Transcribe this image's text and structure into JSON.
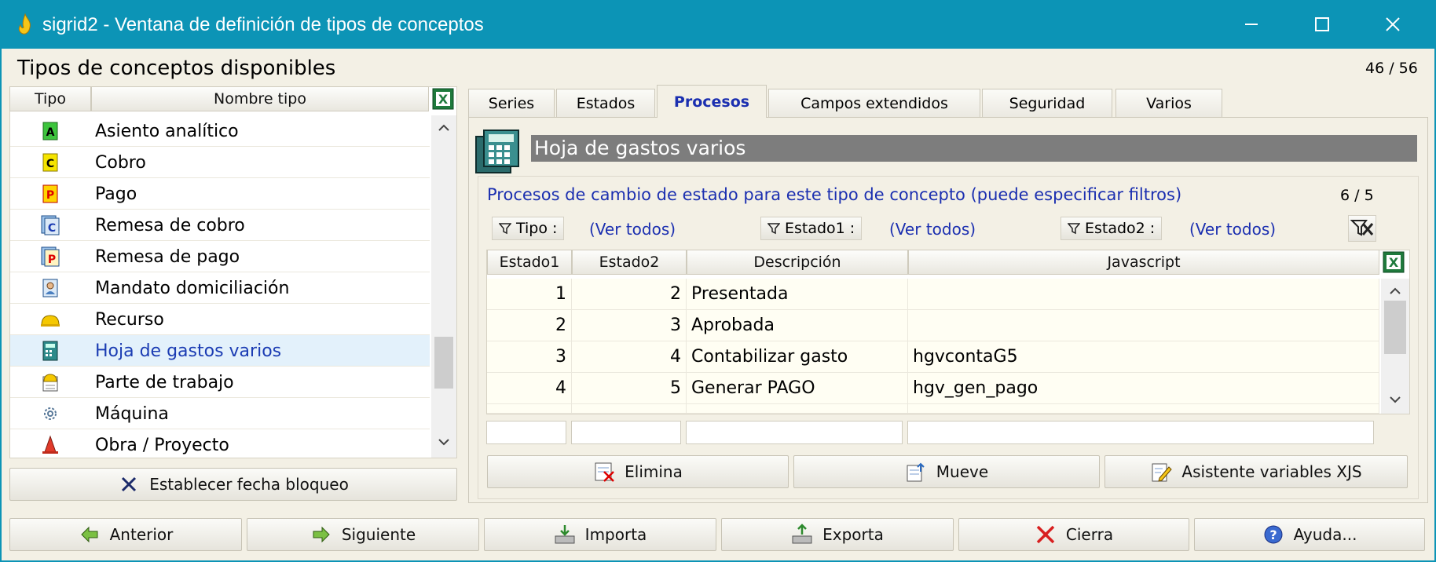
{
  "window": {
    "title": "sigrid2 - Ventana de definición de tipos de conceptos"
  },
  "left": {
    "heading": "Tipos de conceptos disponibles",
    "counter": "46 / 56",
    "columns": [
      "Tipo",
      "Nombre tipo"
    ],
    "items": [
      {
        "label": "Asiento analítico",
        "icon": "A-letter-icon"
      },
      {
        "label": "Cobro",
        "icon": "C-letter-icon"
      },
      {
        "label": "Pago",
        "icon": "P-letter-icon"
      },
      {
        "label": "Remesa de cobro",
        "icon": "remesa-cobro-icon"
      },
      {
        "label": "Remesa de pago",
        "icon": "remesa-pago-icon"
      },
      {
        "label": "Mandato domiciliación",
        "icon": "mandato-icon"
      },
      {
        "label": "Recurso",
        "icon": "helmet-icon"
      },
      {
        "label": "Hoja de gastos varios",
        "icon": "calculator-icon",
        "selected": true
      },
      {
        "label": "Parte de trabajo",
        "icon": "work-report-icon"
      },
      {
        "label": "Máquina",
        "icon": "gear-icon"
      },
      {
        "label": "Obra / Proyecto",
        "icon": "cone-icon"
      }
    ],
    "lock_button": "Establecer fecha bloqueo"
  },
  "tabs": [
    "Series",
    "Estados",
    "Procesos",
    "Campos extendidos",
    "Seguridad",
    "Varios"
  ],
  "active_tab": "Procesos",
  "concept_name": "Hoja de gastos varios",
  "procesos": {
    "heading": "Procesos de cambio de estado para este tipo de concepto (puede especificar filtros)",
    "counter": "6 / 5",
    "filters": [
      {
        "label": "Tipo :",
        "value": "(Ver todos)"
      },
      {
        "label": "Estado1 :",
        "value": "(Ver todos)"
      },
      {
        "label": "Estado2 :",
        "value": "(Ver todos)"
      }
    ],
    "columns": [
      "Estado1",
      "Estado2",
      "Descripción",
      "Javascript"
    ],
    "rows": [
      {
        "e1": "1",
        "e2": "2",
        "desc": "Presentada",
        "js": ""
      },
      {
        "e1": "2",
        "e2": "3",
        "desc": "Aprobada",
        "js": ""
      },
      {
        "e1": "3",
        "e2": "4",
        "desc": "Contabilizar gasto",
        "js": "hgvcontaG5"
      },
      {
        "e1": "4",
        "e2": "5",
        "desc": "Generar PAGO",
        "js": "hgv_gen_pago"
      }
    ],
    "actions": [
      "Elimina",
      "Mueve",
      "Asistente variables XJS"
    ]
  },
  "footer": [
    "Anterior",
    "Siguiente",
    "Importa",
    "Exporta",
    "Cierra",
    "Ayuda..."
  ],
  "colors": {
    "titlebar": "#0c94b6",
    "selected_text": "#1b3cb3",
    "link_blue": "#1b2fb0",
    "background": "#f3f0e5"
  }
}
